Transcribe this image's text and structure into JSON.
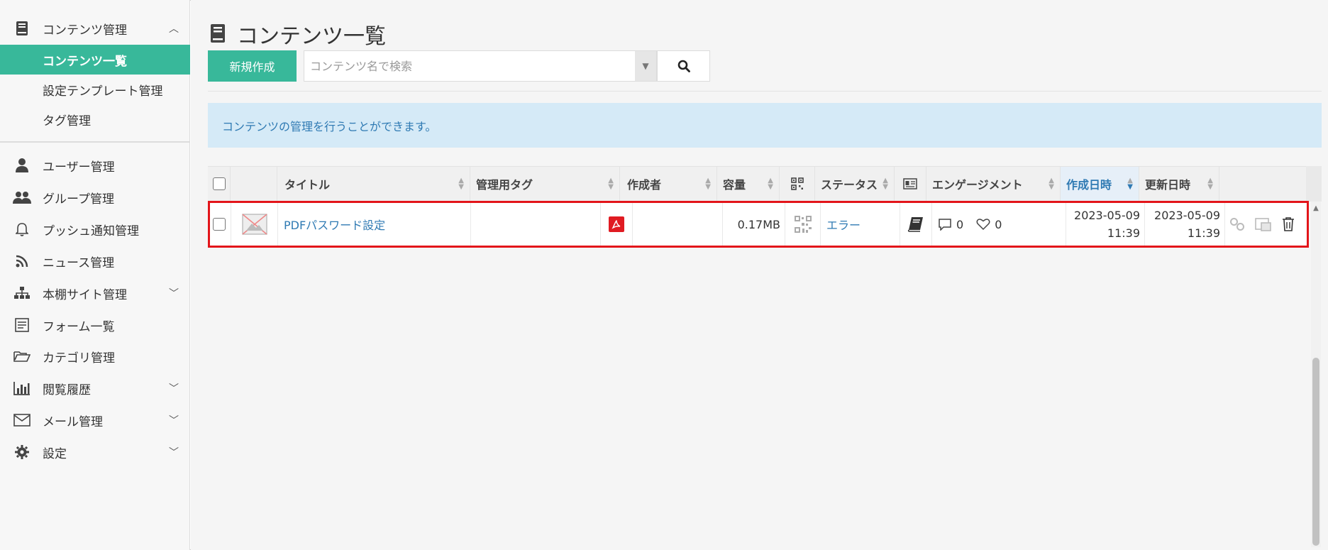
{
  "sidebar": {
    "content_mgmt": "コンテンツ管理",
    "content_list": "コンテンツ一覧",
    "settings_template": "設定テンプレート管理",
    "tag_mgmt": "タグ管理",
    "user_mgmt": "ユーザー管理",
    "group_mgmt": "グループ管理",
    "push_mgmt": "プッシュ通知管理",
    "news_mgmt": "ニュース管理",
    "bookshelf_mgmt": "本棚サイト管理",
    "form_list": "フォーム一覧",
    "category_mgmt": "カテゴリ管理",
    "view_history": "閲覧履歴",
    "mail_mgmt": "メール管理",
    "settings": "設定"
  },
  "page": {
    "title": "コンテンツ一覧",
    "new_button": "新規作成",
    "search_placeholder": "コンテンツ名で検索",
    "info": "コンテンツの管理を行うことができます。"
  },
  "table": {
    "headers": {
      "title": "タイトル",
      "tag": "管理用タグ",
      "author": "作成者",
      "size": "容量",
      "status": "ステータス",
      "engagement": "エンゲージメント",
      "created": "作成日時",
      "updated": "更新日時"
    },
    "rows": [
      {
        "title": "PDFパスワード設定",
        "tag": "",
        "author": "",
        "size": "0.17MB",
        "status": "エラー",
        "comments": "0",
        "likes": "0",
        "created_date": "2023-05-09",
        "created_time": "11:39",
        "updated_date": "2023-05-09",
        "updated_time": "11:39"
      }
    ]
  },
  "colors": {
    "accent": "#38b89a",
    "link": "#2f7ab3",
    "highlight": "#e3151a",
    "pdf": "#e01b22"
  }
}
